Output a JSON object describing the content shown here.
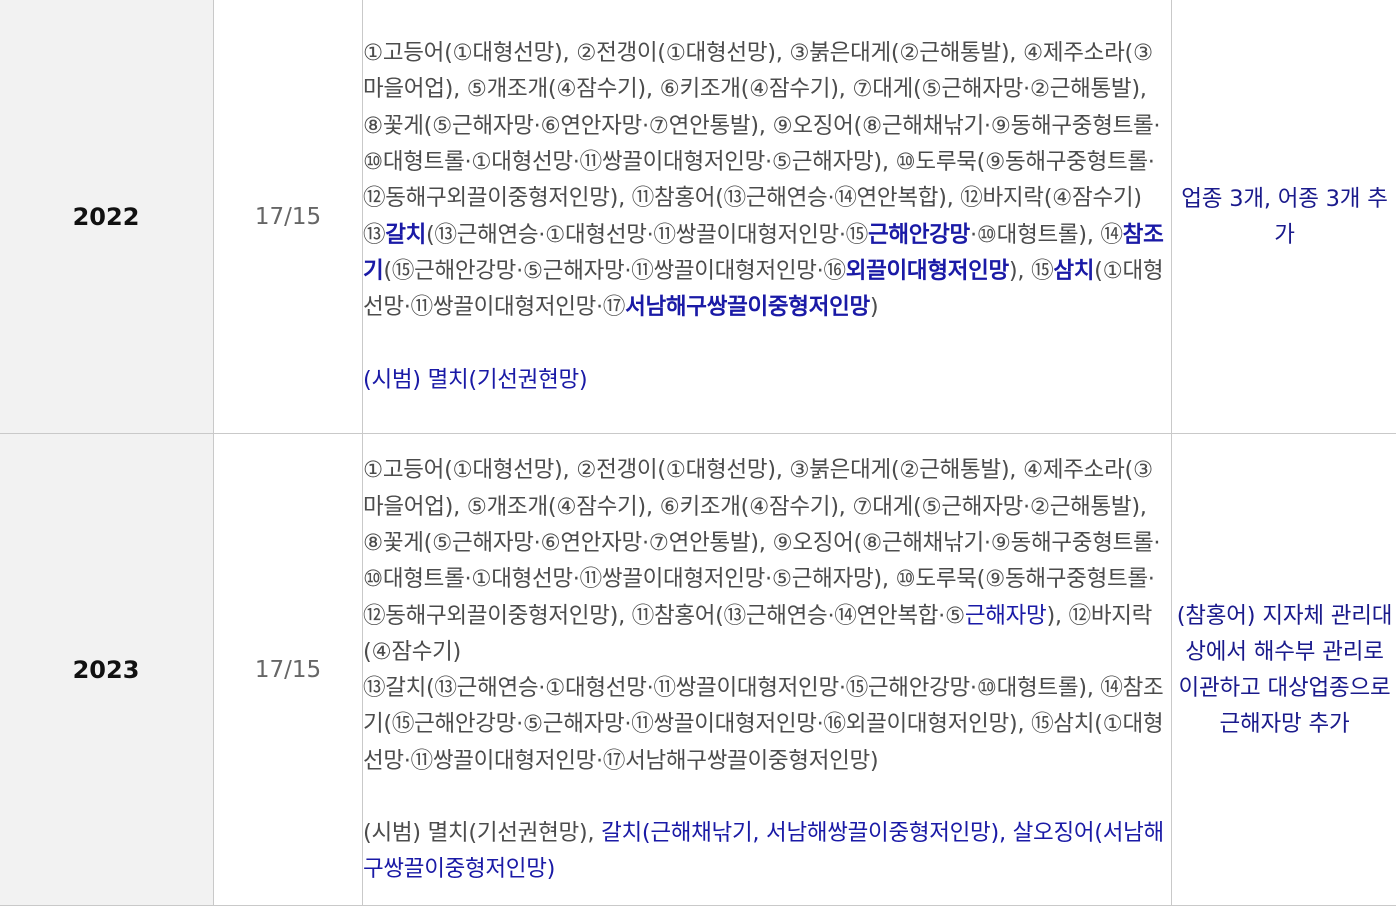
{
  "rows": [
    {
      "year": "2022",
      "count": "17/15",
      "content": {
        "line_a": [
          {
            "t": "①고등어(①대형선망), ②전갱이(①대형선망), ③붉은대게(②근해통발), ④제주소라(③마을어업), ⑤개조개(④잠수기), ⑥키조개(④잠수기), ⑦대게(⑤근해자망·②근해통발), ⑧꽃게(⑤근해자망·⑥연안자망·⑦연안통발), ⑨오징어(⑧근해채낚기·⑨동해구중형트롤·⑩대형트롤·①대형선망·⑪쌍끌이대형저인망·⑤근해자망), ⑩도루묵(⑨동해구중형트롤·⑫동해구외끌이중형저인망), ⑪참홍어(⑬근해연승·⑭연안복합), ⑫바지락(④잠수기)",
            "s": ""
          }
        ],
        "line_b": [
          {
            "t": "⑬",
            "s": ""
          },
          {
            "t": "갈치",
            "s": "hlb"
          },
          {
            "t": "(⑬근해연승·①대형선망·⑪쌍끌이대형저인망·⑮",
            "s": ""
          },
          {
            "t": "근해안강망",
            "s": "hlb"
          },
          {
            "t": "·⑩대형트롤), ⑭",
            "s": ""
          },
          {
            "t": "참조기",
            "s": "hlb"
          },
          {
            "t": "(⑮근해안강망·⑤근해자망·⑪쌍끌이대형저인망·⑯",
            "s": ""
          },
          {
            "t": "외끌이대형저인망",
            "s": "hlb"
          },
          {
            "t": "), ⑮",
            "s": ""
          },
          {
            "t": "삼치",
            "s": "hlb"
          },
          {
            "t": "(①대형선망·⑪쌍끌이대형저인망·⑰",
            "s": ""
          },
          {
            "t": "서남해구쌍끌이중형저인망",
            "s": "hlb"
          },
          {
            "t": ")",
            "s": ""
          }
        ],
        "trial": [
          {
            "t": "(시범) 멸치(기선권현망)",
            "s": "hl"
          }
        ]
      },
      "note": "업종 3개, 어종 3개 추가"
    },
    {
      "year": "2023",
      "count": "17/15",
      "content": {
        "line_a": [
          {
            "t": "①고등어(①대형선망), ②전갱이(①대형선망), ③붉은대게(②근해통발), ④제주소라(③마을어업), ⑤개조개(④잠수기), ⑥키조개(④잠수기), ⑦대게(⑤근해자망·②근해통발), ⑧꽃게(⑤근해자망·⑥연안자망·⑦연안통발), ⑨오징어(⑧근해채낚기·⑨동해구중형트롤·⑩대형트롤·①대형선망·⑪쌍끌이대형저인망·⑤근해자망), ⑩도루묵(⑨동해구중형트롤·⑫동해구외끌이중형저인망), ⑪참홍어(⑬근해연승·⑭연안복합·⑤",
            "s": ""
          },
          {
            "t": "근해자망",
            "s": "hl"
          },
          {
            "t": "), ⑫바지락(④잠수기)",
            "s": ""
          }
        ],
        "line_b": [
          {
            "t": "⑬갈치(⑬근해연승·①대형선망·⑪쌍끌이대형저인망·⑮근해안강망·⑩대형트롤), ⑭참조기(⑮근해안강망·⑤근해자망·⑪쌍끌이대형저인망·⑯외끌이대형저인망), ⑮삼치(①대형선망·⑪쌍끌이대형저인망·⑰서남해구쌍끌이중형저인망)",
            "s": ""
          }
        ],
        "trial": [
          {
            "t": "(시범) 멸치(기선권현망), ",
            "s": ""
          },
          {
            "t": "갈치(근해채낚기, 서남해쌍끌이중형저인망), 살오징어(서남해구쌍끌이중형저인망)",
            "s": "hl"
          }
        ]
      },
      "note": "(참홍어) 지자체 관리대상에서 해수부 관리로 이관하고 대상업종으로 근해자망 추가"
    }
  ],
  "colors": {
    "border": "#c9c9c9",
    "year_bg": "#f2f2f2",
    "highlight": "#1a1aa6",
    "body_text": "#4c4c4c",
    "count_text": "#666666"
  }
}
